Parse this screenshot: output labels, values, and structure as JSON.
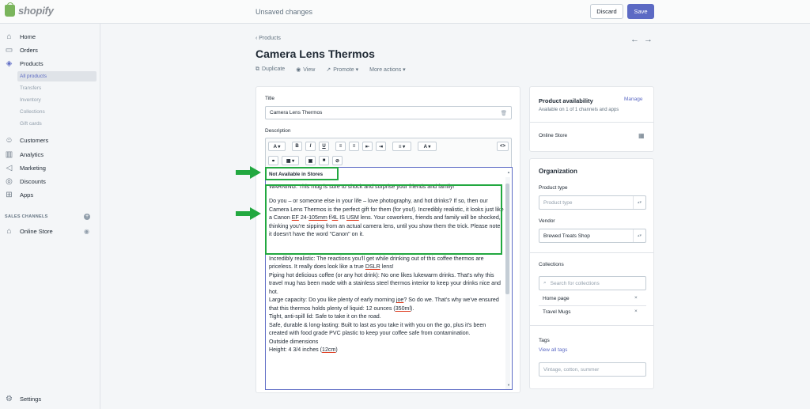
{
  "topbar": {
    "logo_text": "shopify",
    "status": "Unsaved changes",
    "discard_label": "Discard",
    "save_label": "Save",
    "save_color": "#5c6ac4"
  },
  "sidebar": {
    "items": [
      {
        "label": "Home",
        "icon": "home-icon"
      },
      {
        "label": "Orders",
        "icon": "orders-icon"
      },
      {
        "label": "Products",
        "icon": "tag-icon"
      },
      {
        "label": "Customers",
        "icon": "customers-icon"
      },
      {
        "label": "Analytics",
        "icon": "chart-icon"
      },
      {
        "label": "Marketing",
        "icon": "megaphone-icon"
      },
      {
        "label": "Discounts",
        "icon": "discount-icon"
      },
      {
        "label": "Apps",
        "icon": "apps-icon"
      }
    ],
    "product_subitems": [
      "All products",
      "Transfers",
      "Inventory",
      "Collections",
      "Gift cards"
    ],
    "sales_channels_heading": "SALES CHANNELS",
    "online_store": "Online Store",
    "settings": "Settings"
  },
  "header": {
    "breadcrumb": "Products",
    "title": "Camera Lens Thermos",
    "actions": [
      {
        "label": "Duplicate",
        "icon": "duplicate-icon"
      },
      {
        "label": "View",
        "icon": "eye-icon"
      },
      {
        "label": "Promote",
        "icon": "share-icon"
      },
      {
        "label": "More actions",
        "icon": ""
      }
    ]
  },
  "form": {
    "title_label": "Title",
    "title_value": "Camera Lens Thermos",
    "description_label": "Description",
    "toolbar_row1": [
      "A",
      "B",
      "I",
      "U",
      "≡",
      "≡",
      "⇤",
      "⇥",
      "≡",
      "A",
      "<>"
    ],
    "first_line": "Not Available in Stores",
    "para_warning": "WARNING: This mug is sure to shock and surprise your friends and family!",
    "para_intro_a": "Do you – or someone else in your life – love photography, and hot drinks? If so, then our Camera Lens Thermos is the perfect gift for them (for you!). Incredibly realistic, it looks just like a Canon ",
    "ef": "EF",
    "mid1": " 24-",
    "mm": "105mm",
    "mid2": " f/",
    "fl": "4L",
    "mid3": " IS ",
    "usm": "USM",
    "para_intro_b": " lens. Your coworkers, friends and family will be shocked, thinking you're sipping from an actual camera lens, until you show them the trick. Please note, it doesn't have the word \"Canon\" on it.",
    "para_realistic_a": "Incredibly realistic: The reactions you'll get while drinking out of this coffee thermos are priceless. It really does look like a true ",
    "dslr": "DSLR",
    "para_realistic_b": " lens!",
    "para_piping": "Piping hot delicious coffee (or any hot drink): No one likes lukewarm drinks. That's why this travel mug has been made with a stainless steel thermos interior to keep your drinks nice and hot.",
    "para_capacity_a": "Large capacity: Do you like plenty of early morning ",
    "joe": "joe",
    "para_capacity_b": "? So do we. That's why we've ensured that this thermos holds plenty of liquid: 12 ounces (",
    "ml": "350ml",
    "para_capacity_c": ").",
    "para_tight": "Tight, anti-spill lid: Safe to take it on the road.",
    "para_safe": "Safe, durable & long-lasting: Built to last as you take it with you on the go, plus it's been created with food grade PVC plastic to keep your coffee safe from contamination.",
    "para_outside": "Outside dimensions",
    "para_height_a": "Height: 4 3/4 inches (",
    "cm": "12cm",
    "para_height_b": ")"
  },
  "availability": {
    "heading": "Product availability",
    "manage": "Manage",
    "subtext": "Available on 1 of 1 channels and apps",
    "channel": "Online Store"
  },
  "organization": {
    "heading": "Organization",
    "product_type_label": "Product type",
    "product_type_placeholder": "Product type",
    "vendor_label": "Vendor",
    "vendor_value": "Brewed Treats Shop",
    "collections_label": "Collections",
    "collections_placeholder": "Search for collections",
    "collections": [
      "Home page",
      "Travel Mugs"
    ],
    "tags_label": "Tags",
    "view_all_tags": "View all tags",
    "tags_placeholder": "Vintage, cotton, summer"
  },
  "annotation_color": "#22a840"
}
